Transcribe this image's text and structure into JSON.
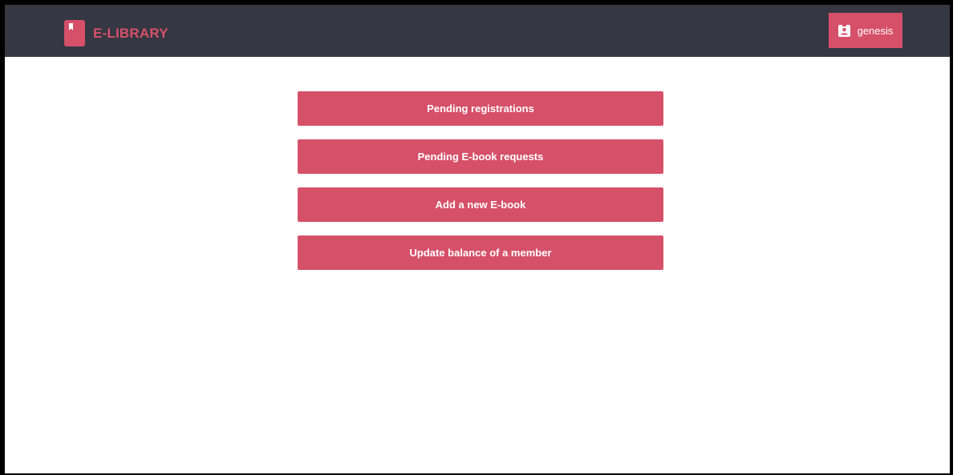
{
  "navbar": {
    "brand_icon": "book-icon",
    "brand_text": "E-LIBRARY",
    "user_icon": "contact-card-icon",
    "username": "genesis"
  },
  "actions": [
    {
      "label": "Pending registrations"
    },
    {
      "label": "Pending E-book requests"
    },
    {
      "label": "Add a new E-book"
    },
    {
      "label": "Update balance of a member"
    }
  ],
  "colors": {
    "navbar_bg": "#353742",
    "accent": "#d6506a",
    "page_bg": "#ffffff"
  }
}
